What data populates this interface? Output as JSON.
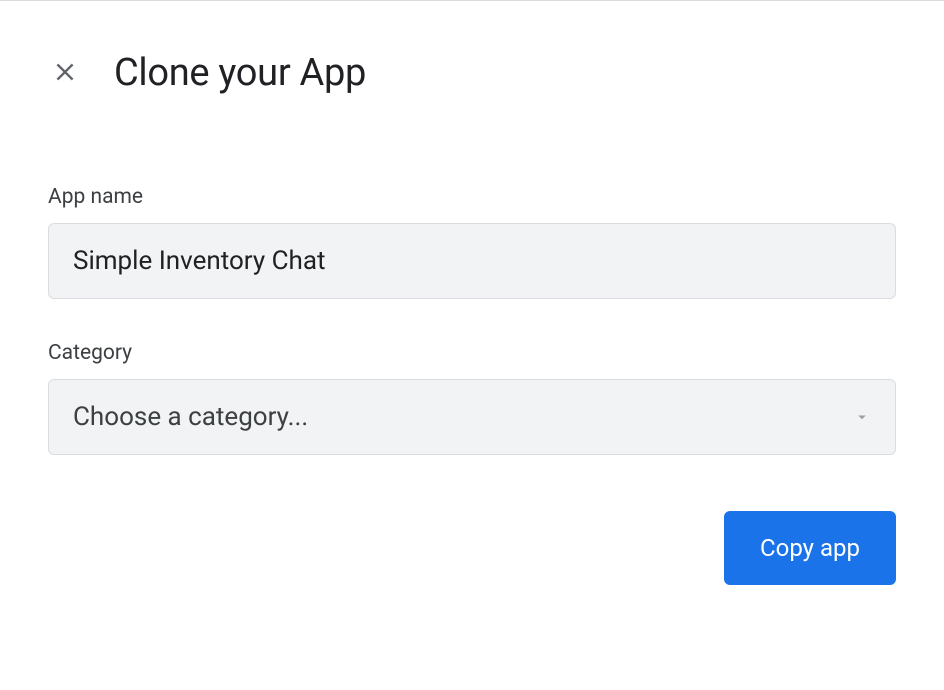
{
  "dialog": {
    "title": "Clone your App"
  },
  "form": {
    "appName": {
      "label": "App name",
      "value": "Simple Inventory Chat"
    },
    "category": {
      "label": "Category",
      "placeholder": "Choose a category..."
    }
  },
  "actions": {
    "copy_label": "Copy app"
  }
}
